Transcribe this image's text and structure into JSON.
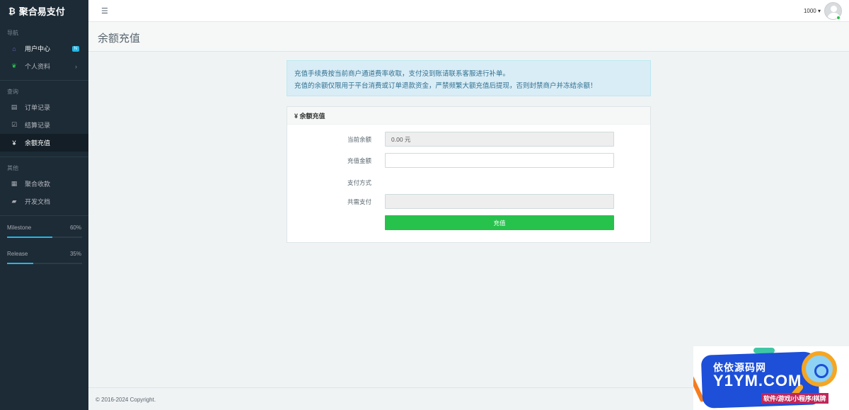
{
  "brand": {
    "logo_glyph": "₿",
    "name": "聚合易支付"
  },
  "sidebar": {
    "sections": [
      {
        "header": "导航"
      },
      {
        "header": "查询"
      },
      {
        "header": "其他"
      }
    ],
    "items": [
      {
        "label": "用户中心",
        "icon": "home-icon",
        "glyph": "⌂",
        "badge": "N"
      },
      {
        "label": "个人资料",
        "icon": "leaf-icon",
        "glyph": "❦",
        "arrow": "›"
      },
      {
        "label": "订单记录",
        "icon": "list-icon",
        "glyph": "▤"
      },
      {
        "label": "结算记录",
        "icon": "check-square-icon",
        "glyph": "☑"
      },
      {
        "label": "余额充值",
        "icon": "yen-icon",
        "glyph": "¥"
      },
      {
        "label": "聚合收款",
        "icon": "qrcode-icon",
        "glyph": "▦"
      },
      {
        "label": "开发文档",
        "icon": "book-icon",
        "glyph": "▰"
      }
    ],
    "progress": [
      {
        "label": "Milestone",
        "value_text": "60%",
        "value": 0.6
      },
      {
        "label": "Release",
        "value_text": "35%",
        "value": 0.35
      }
    ]
  },
  "topbar": {
    "menu_glyph": "☰",
    "user_name": "1000 ▾"
  },
  "page": {
    "title": "余额充值"
  },
  "alert": {
    "line1": "充值手续费按当前商户通道费率收取，支付没到账请联系客服进行补单。",
    "line2": "充值的余额仅限用于平台消费或订单退款资金，严禁频繁大额充值后提现，否则封禁商户并冻结余额！"
  },
  "panel": {
    "heading": "¥ 余额充值",
    "fields": {
      "balance_label": "当前余额",
      "balance_value": "0.00 元",
      "amount_label": "充值金额",
      "amount_value": "",
      "method_label": "支付方式",
      "total_label": "共需支付",
      "total_value": ""
    },
    "submit_label": "充值"
  },
  "footer": {
    "copyright": "© 2016-2024 Copyright."
  },
  "watermark": {
    "line1": "依依源码网",
    "line2": "Y1YM.COM",
    "line3": "软件/游戏/小程序/棋牌"
  },
  "colors": {
    "sidebar_bg": "#1c2b36",
    "accent_blue": "#23b7e5",
    "success_green": "#27c24c",
    "alert_bg": "#d9edf7"
  }
}
